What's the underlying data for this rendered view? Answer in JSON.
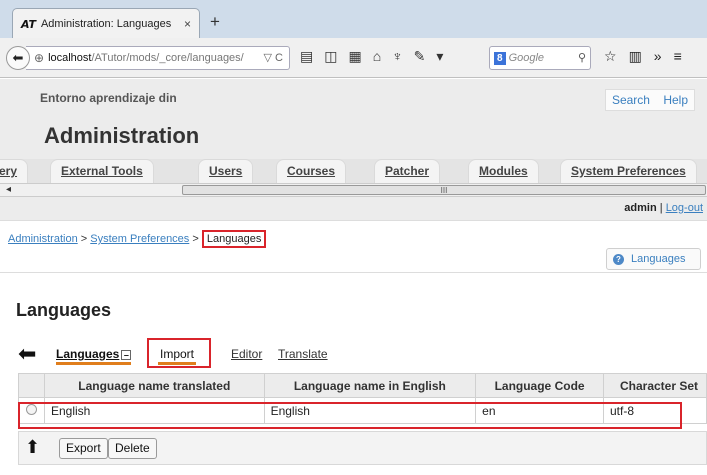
{
  "browser": {
    "tab_logo": "AT",
    "tab_title": "Administration: Languages",
    "tab_close": "×",
    "new_tab": "+",
    "url_host": "localhost",
    "url_path": "/ATutor/mods/_core/languages/",
    "url_controls": "▽ C",
    "search_engine": "8",
    "search_placeholder": "Google",
    "toolbar_icons": [
      "reader-icon",
      "sidebar-icon",
      "grid-icon",
      "home-icon",
      "extension-icon",
      "tool-icon",
      "dropdown-icon"
    ],
    "right_icons": [
      "bookmark-star-icon",
      "library-icon",
      "overflow-icon",
      "menu-icon"
    ]
  },
  "site": {
    "name": "Entorno aprendizaje din",
    "search_label": "Search",
    "help_label": "Help",
    "title": "Administration"
  },
  "nav_tabs": [
    "ery",
    "External Tools",
    "Users",
    "Courses",
    "Patcher",
    "Modules",
    "System Preferences"
  ],
  "scrollbar": {
    "left_arrow": "◂",
    "thumb_grip": "III"
  },
  "user": {
    "name": "admin",
    "separator": "|",
    "logout": "Log-out"
  },
  "breadcrumb": {
    "items": [
      "Administration",
      "System Preferences"
    ],
    "separator": ">",
    "current": "Languages"
  },
  "help_tab": {
    "icon": "?",
    "label": "Languages"
  },
  "heading": "Languages",
  "subnav": {
    "active": "Languages",
    "collapse_glyph": "–",
    "import": "Import",
    "editor": "Editor",
    "translate": "Translate"
  },
  "table": {
    "headers": [
      "",
      "Language name translated",
      "Language name in English",
      "Language Code",
      "Character Set"
    ],
    "rows": [
      {
        "name_translated": "English",
        "name_english": "English",
        "code": "en",
        "charset": "utf-8"
      }
    ]
  },
  "actions": {
    "export": "Export",
    "delete": "Delete"
  },
  "colors": {
    "highlight_red": "#d9242b",
    "tab_underline": "#e07e1c",
    "link_blue": "#3a7fbf"
  }
}
